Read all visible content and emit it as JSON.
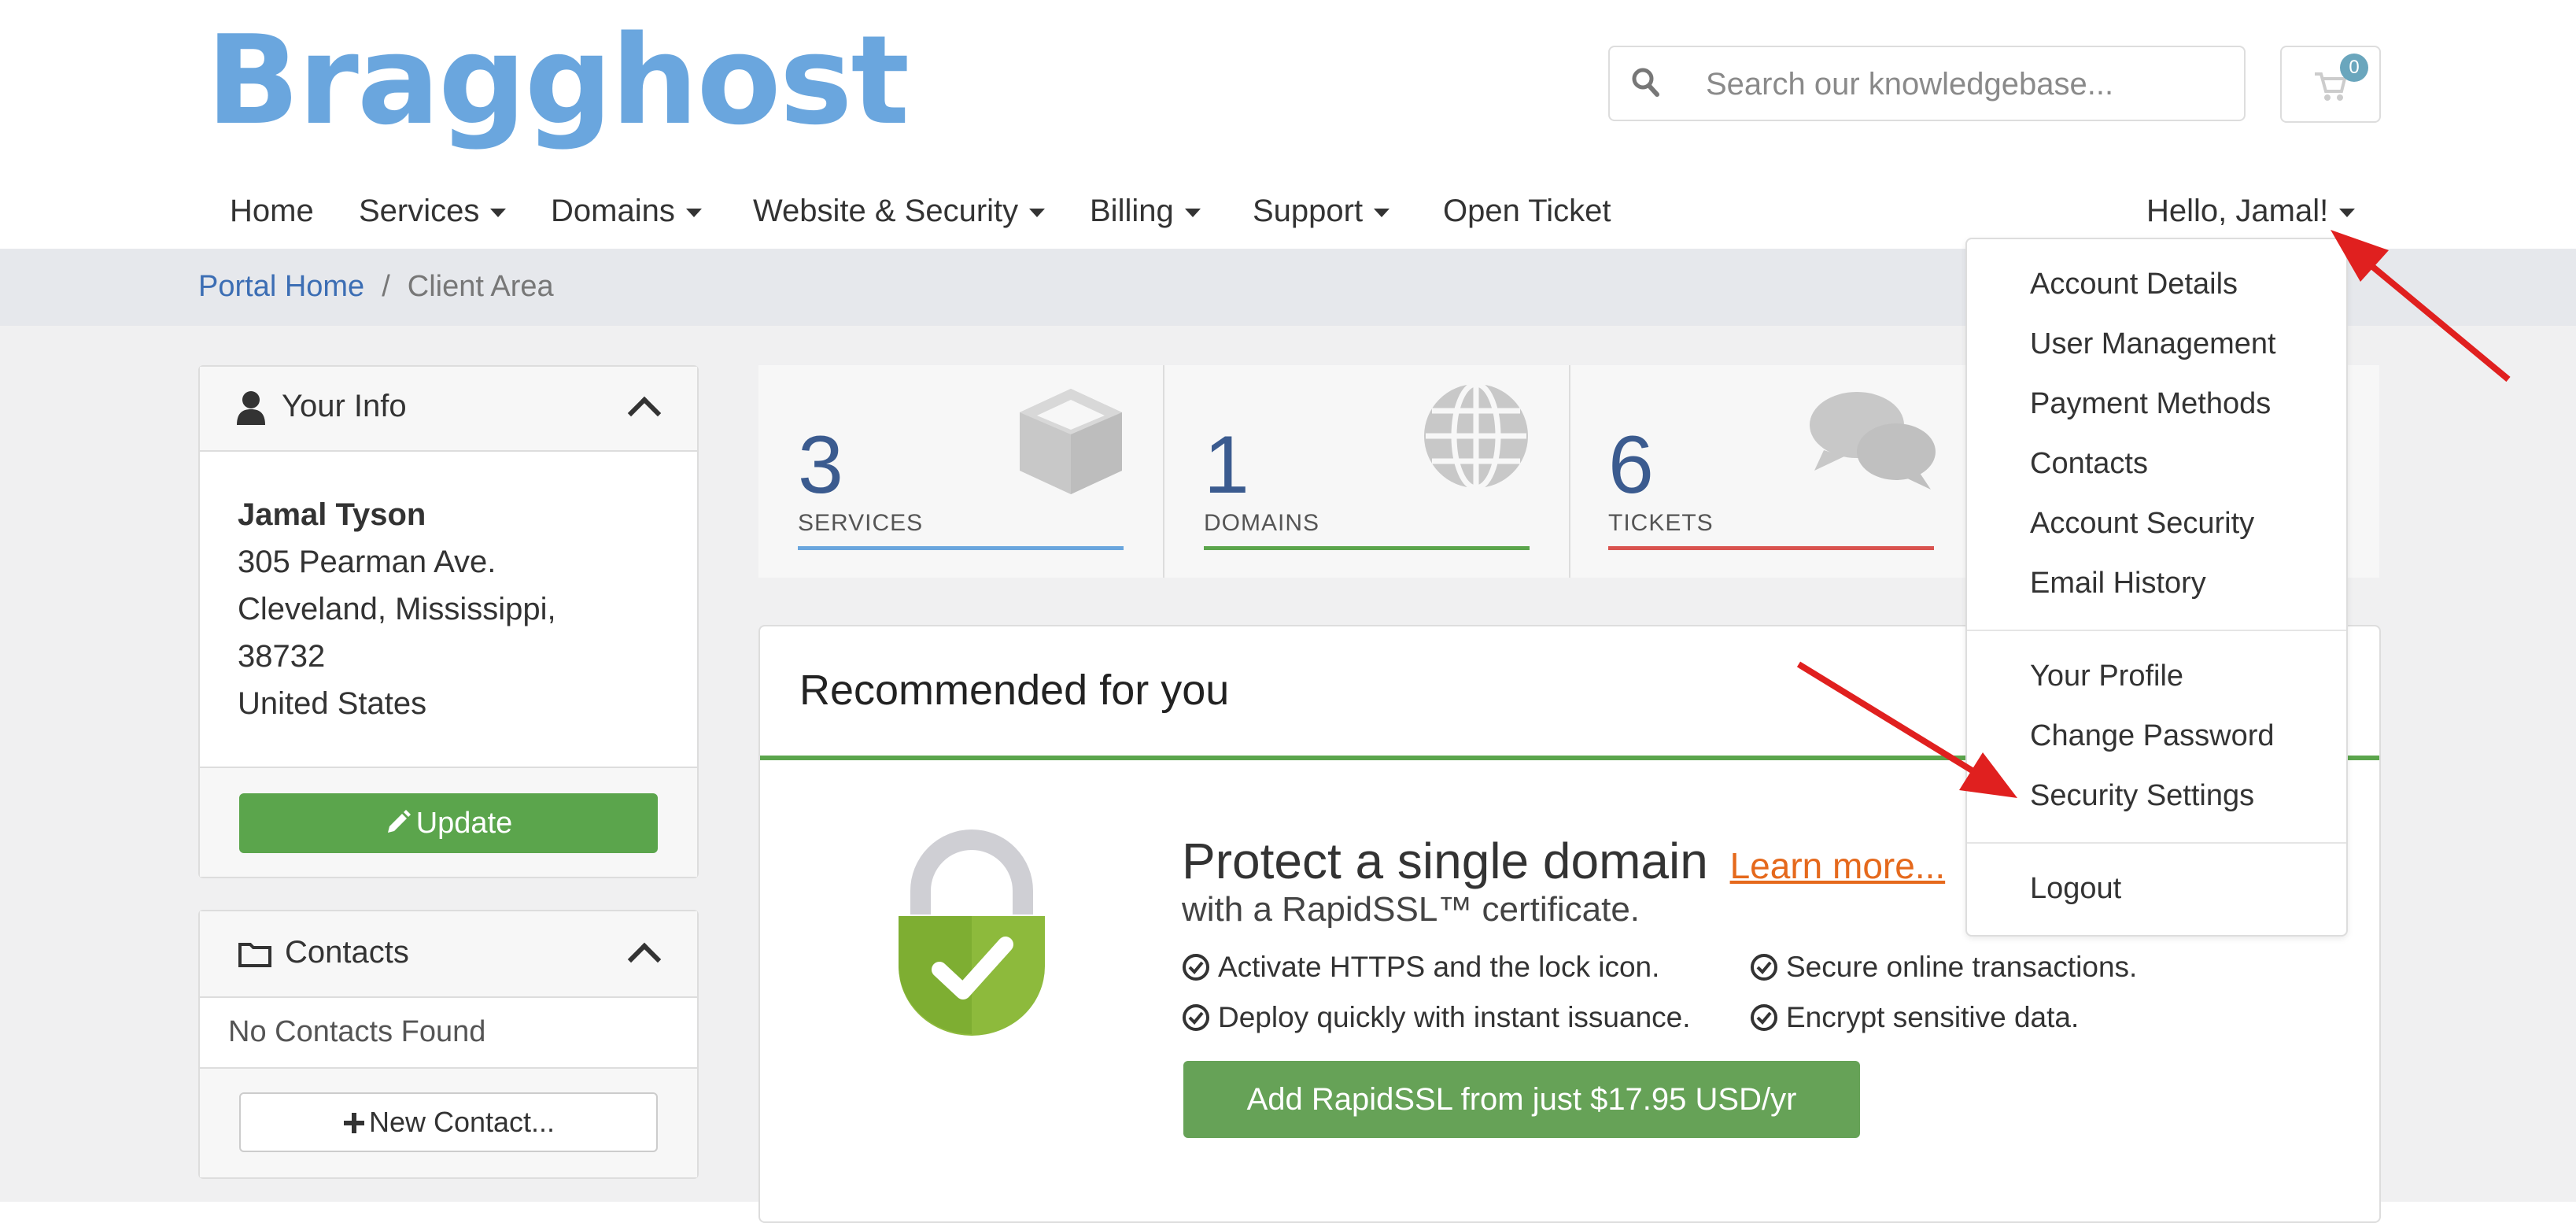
{
  "brand": {
    "logo_text": "Bragghost",
    "logo_color": "#6aa6de"
  },
  "search": {
    "placeholder": "Search our knowledgebase...",
    "icon": "search-icon"
  },
  "cart": {
    "count": "0",
    "icon": "shopping-cart-icon"
  },
  "nav": {
    "items": [
      {
        "label": "Home",
        "has_dropdown": false
      },
      {
        "label": "Services",
        "has_dropdown": true
      },
      {
        "label": "Domains",
        "has_dropdown": true
      },
      {
        "label": "Website & Security",
        "has_dropdown": true
      },
      {
        "label": "Billing",
        "has_dropdown": true
      },
      {
        "label": "Support",
        "has_dropdown": true
      },
      {
        "label": "Open Ticket",
        "has_dropdown": false
      }
    ],
    "user_menu_label": "Hello, Jamal!"
  },
  "breadcrumb": {
    "home": "Portal Home",
    "separator": "/",
    "current": "Client Area"
  },
  "your_info": {
    "title": "Your Info",
    "name": "Jamal Tyson",
    "address_line1": "305 Pearman Ave.",
    "address_line2": "Cleveland, Mississippi,",
    "postcode": "38732",
    "country": "United States",
    "update_label": "Update"
  },
  "contacts": {
    "title": "Contacts",
    "empty_text": "No Contacts Found",
    "new_contact_label": "New Contact..."
  },
  "stats": [
    {
      "value": "3",
      "label": "SERVICES",
      "icon": "cube-icon",
      "accent": "#6aa6de"
    },
    {
      "value": "1",
      "label": "DOMAINS",
      "icon": "globe-icon",
      "accent": "#5ba54c"
    },
    {
      "value": "6",
      "label": "TICKETS",
      "icon": "comments-icon",
      "accent": "#d9534f"
    }
  ],
  "recommended": {
    "title": "Recommended for you",
    "product_title": "Protect a single domain",
    "learn_more": "Learn more...",
    "subtitle": "with a RapidSSL™ certificate.",
    "features": [
      "Activate HTTPS and the lock icon.",
      "Secure online transactions.",
      "Deploy quickly with instant issuance.",
      "Encrypt sensitive data."
    ],
    "cta_label": "Add RapidSSL from just $17.95 USD/yr",
    "accent": "#5ba54c",
    "link_color": "#e5691c"
  },
  "user_dropdown": {
    "group1": [
      "Account Details",
      "User Management",
      "Payment Methods",
      "Contacts",
      "Account Security",
      "Email History"
    ],
    "group2": [
      "Your Profile",
      "Change Password",
      "Security Settings"
    ],
    "group3": [
      "Logout"
    ]
  },
  "annotation_color": "#e0201f"
}
